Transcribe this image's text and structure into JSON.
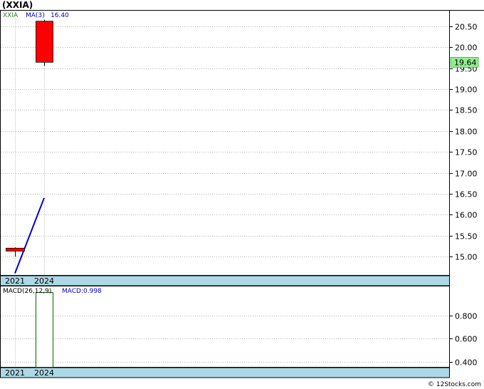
{
  "title": "(XXIA)",
  "watermark": "© 12Stocks.com",
  "colors": {
    "up": "#ffffff",
    "down": "#ff0000",
    "ma_line": "#0000cc",
    "macd_bar_border": "#006600",
    "date_band": "#add8e6",
    "price_tag": "#90ee90",
    "symbol_text": "#2e7d32",
    "ma_text": "#0000cc"
  },
  "chart_data": [
    {
      "type": "candlestick",
      "symbol": "XXIA",
      "legend": {
        "symbol": "XXIA",
        "ma_label": "MA(3)",
        "ma_value": "16.40"
      },
      "x_ticks": [
        "2021",
        "2024"
      ],
      "candles": [
        {
          "x": "2021",
          "open": 15.2,
          "high": 15.22,
          "low": 15.0,
          "close": 15.13
        },
        {
          "x": "2024",
          "open": 20.62,
          "high": 20.65,
          "low": 19.55,
          "close": 19.64
        }
      ],
      "ma_series": {
        "name": "MA(3)",
        "values": [
          14.6,
          16.4
        ]
      },
      "last_price": "19.64",
      "y_ticks": [
        "20.50",
        "20.00",
        "19.50",
        "19.00",
        "18.50",
        "18.00",
        "17.50",
        "17.00",
        "16.50",
        "16.00",
        "15.50",
        "15.00"
      ],
      "ylim": [
        14.55,
        20.88
      ],
      "grid": true
    },
    {
      "type": "bar",
      "indicator": "MACD",
      "legend": {
        "label": "MACD(26,12,9)",
        "value_label": "MACD:0.998"
      },
      "x_ticks": [
        "2021",
        "2024"
      ],
      "bars": [
        {
          "x": "2024",
          "value": 0.998
        }
      ],
      "y_ticks": [
        "0.800",
        "0.600",
        "0.400"
      ],
      "ylim": [
        0.355,
        1.053
      ],
      "grid": true
    }
  ]
}
